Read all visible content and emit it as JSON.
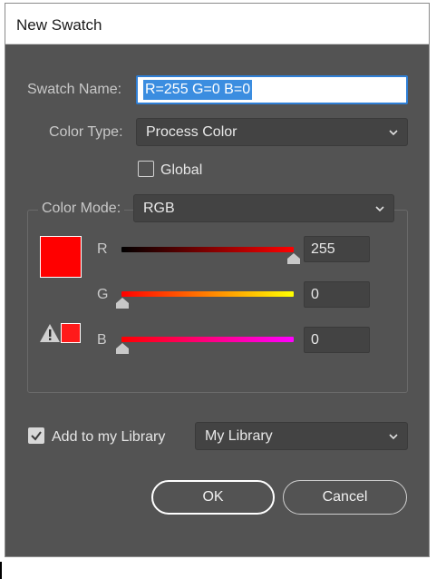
{
  "window": {
    "title": "New Swatch"
  },
  "swatch_name": {
    "label": "Swatch Name:",
    "value": "R=255 G=0 B=0"
  },
  "color_type": {
    "label": "Color Type:",
    "value": "Process Color"
  },
  "global": {
    "label": "Global",
    "checked": false
  },
  "color_mode": {
    "label": "Color Mode:",
    "value": "RGB"
  },
  "channels": [
    {
      "name": "R",
      "value": "255"
    },
    {
      "name": "G",
      "value": "0"
    },
    {
      "name": "B",
      "value": "0"
    }
  ],
  "preview": {
    "color": "#ff0000"
  },
  "library": {
    "label": "Add to my Library",
    "checked": true,
    "value": "My Library"
  },
  "buttons": {
    "ok": "OK",
    "cancel": "Cancel"
  },
  "colors": {
    "dialog_bg": "#535353",
    "accent": "#2f7fd6"
  }
}
